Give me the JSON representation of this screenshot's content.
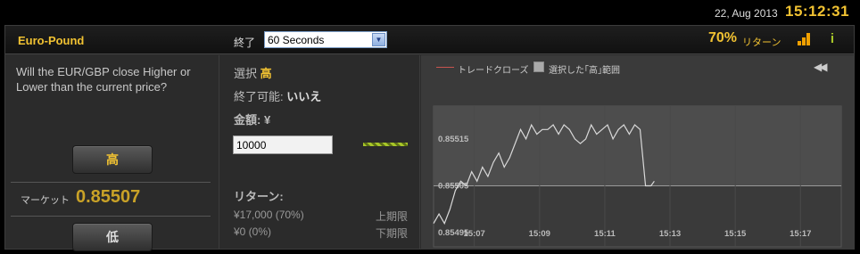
{
  "topbar": {
    "date": "22, Aug 2013",
    "time": "15:12:31"
  },
  "header": {
    "asset": "Euro-Pound",
    "expiry_label": "終了",
    "expiry_value": "60 Seconds",
    "return_pct": "70%",
    "return_label": "リターン",
    "icons": [
      "bar-chart-icon",
      "info-icon",
      "chevron-down-icon"
    ]
  },
  "left": {
    "question": "Will the EUR/GBP close Higher or Lower than the current price?",
    "high_label": "高",
    "market_label": "マーケット",
    "market_price": "0.85507",
    "low_label": "低"
  },
  "mid": {
    "selection_label": "選択",
    "selection_value": "高",
    "expiry_label": "終了可能:",
    "expiry_value": "いいえ",
    "amount_label": "金額: ¥",
    "amount_value": "10000",
    "returns_title": "リターン:",
    "return_upper": "¥17,000 (70%)",
    "upper_label": "上期限",
    "return_lower": "¥0 (0%)",
    "lower_label": "下期限"
  },
  "colors": {
    "accent": "#f1c232",
    "price": "#c9a227",
    "trade_line": "#c8544f",
    "green": "#a7c629"
  },
  "chart_data": {
    "type": "line",
    "title": "",
    "legend": [
      {
        "name": "トレードクローズ",
        "color": "#c8544f"
      },
      {
        "name": "選択した｢高｣範囲",
        "color": "#aaaaaa"
      }
    ],
    "x_ticks": [
      "15:07",
      "15:09",
      "15:11",
      "15:13",
      "15:15",
      "15:17"
    ],
    "y_ticks": [
      "0.85515",
      "0.85505",
      "0.85495"
    ],
    "ylim": [
      0.85492,
      0.85522
    ],
    "xlim": [
      "15:05:45",
      "15:18:15"
    ],
    "grid": true,
    "shaded_range": [
      0.85505,
      0.85522
    ],
    "series": [
      {
        "x": [
          "15:05:45",
          "15:05:55",
          "15:06:05",
          "15:06:15",
          "15:06:25",
          "15:06:35",
          "15:06:45",
          "15:06:55",
          "15:07:05",
          "15:07:15",
          "15:07:25",
          "15:07:35",
          "15:07:45",
          "15:07:55",
          "15:08:05",
          "15:08:15",
          "15:08:25",
          "15:08:35",
          "15:08:45",
          "15:08:55",
          "15:09:05",
          "15:09:15",
          "15:09:25",
          "15:09:35",
          "15:09:45",
          "15:09:55",
          "15:10:05",
          "15:10:15",
          "15:10:25",
          "15:10:35",
          "15:10:45",
          "15:10:55",
          "15:11:05",
          "15:11:15",
          "15:11:25",
          "15:11:35",
          "15:11:45",
          "15:11:55",
          "15:12:05",
          "15:12:15",
          "15:12:25",
          "15:12:31"
        ],
        "values": [
          0.85497,
          0.85499,
          0.85497,
          0.855,
          0.85504,
          0.85506,
          0.85505,
          0.85508,
          0.85506,
          0.85509,
          0.85507,
          0.8551,
          0.85512,
          0.85509,
          0.85511,
          0.85514,
          0.85517,
          0.85515,
          0.85518,
          0.85516,
          0.85517,
          0.85517,
          0.85518,
          0.85516,
          0.85518,
          0.85517,
          0.85515,
          0.85514,
          0.85515,
          0.85518,
          0.85516,
          0.85517,
          0.85518,
          0.85515,
          0.85517,
          0.85518,
          0.85516,
          0.85518,
          0.85517,
          0.85505,
          0.85505,
          0.85506
        ]
      }
    ]
  }
}
